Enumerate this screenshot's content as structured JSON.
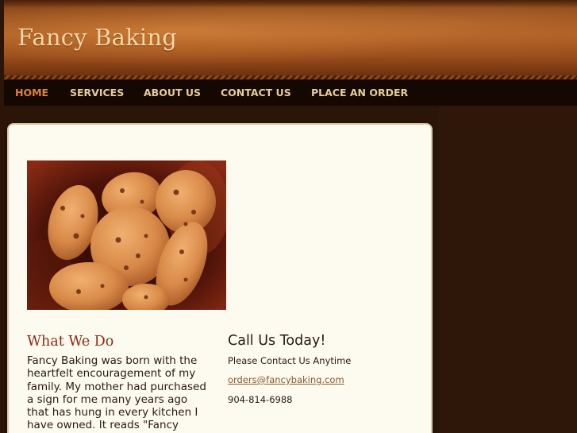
{
  "site": {
    "title": "Fancy Baking"
  },
  "nav": {
    "items": [
      {
        "label": "HOME",
        "active": true
      },
      {
        "label": "SERVICES",
        "active": false
      },
      {
        "label": "ABOUT US",
        "active": false
      },
      {
        "label": "CONTACT US",
        "active": false
      },
      {
        "label": "PLACE AN ORDER",
        "active": false
      }
    ]
  },
  "main": {
    "photo": {
      "subject": "chocolate chip cookies in a bowl"
    },
    "what_we_do": {
      "heading": "What We Do",
      "body": "Fancy Baking was born with the heartfelt encouragement of my family.  My mother had purchased a sign for me many years ago that has hung in every kitchen I have owned.  It reads \"Fancy Baking, Our"
    },
    "contact": {
      "heading": "Call Us Today!",
      "subtext": "Please Contact Us Anytime",
      "email": "orders@fancybaking.com",
      "phone": "904-814-6988"
    }
  },
  "colors": {
    "background": "#2b1408",
    "nav_background": "#150802",
    "nav_text": "#e7cc9c",
    "nav_active": "#e0823a",
    "title": "#f6d7a4",
    "panel": "#fdfaef",
    "heading_accent": "#8a2a12",
    "link": "#8a5a2a"
  }
}
